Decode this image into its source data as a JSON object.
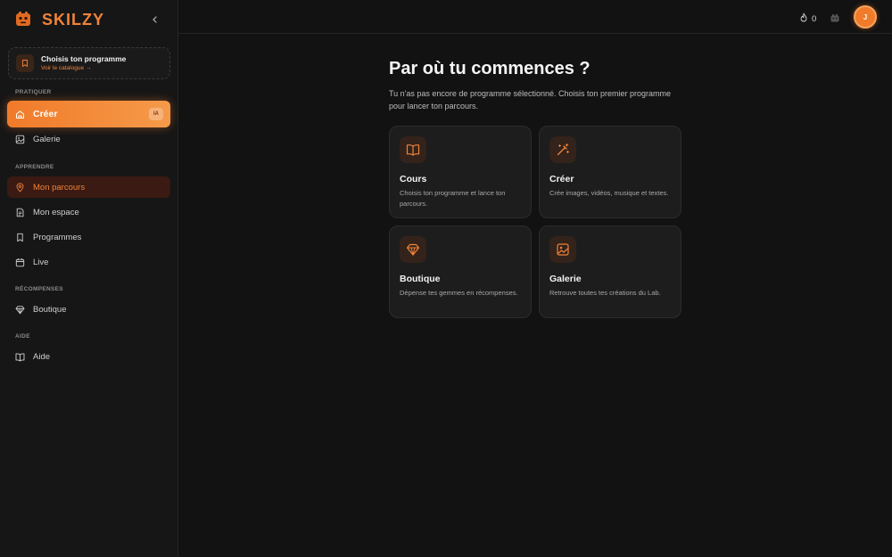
{
  "brand": {
    "name": "SKILZY",
    "accent": "#f0833a"
  },
  "sidebar": {
    "program_card": {
      "title": "Choisis ton programme",
      "link": "Voir le catalogue →"
    },
    "sections": {
      "pratiquer": "PRATIQUER",
      "apprendre": "APPRENDRE",
      "recompenses": "RÉCOMPENSES",
      "aide": "AIDE"
    },
    "items": {
      "creer": {
        "label": "Créer",
        "badge": "IA",
        "icon": "home-sparkle-icon"
      },
      "galerie": {
        "label": "Galerie",
        "icon": "image-icon"
      },
      "parcours": {
        "label": "Mon parcours",
        "icon": "map-pin-icon"
      },
      "espace": {
        "label": "Mon espace",
        "icon": "document-icon"
      },
      "programmes": {
        "label": "Programmes",
        "icon": "bookmark-icon"
      },
      "live": {
        "label": "Live",
        "icon": "calendar-icon"
      },
      "boutique": {
        "label": "Boutique",
        "icon": "gem-icon"
      },
      "aide": {
        "label": "Aide",
        "icon": "book-open-icon"
      }
    }
  },
  "topbar": {
    "streak_count": "0",
    "avatar_initial": "J"
  },
  "main": {
    "title": "Par où tu commences ?",
    "subtitle": "Tu n'as pas encore de programme sélectionné. Choisis ton premier programme pour lancer ton parcours.",
    "cards": [
      {
        "title": "Cours",
        "desc": "Choisis ton programme et lance ton parcours.",
        "icon": "book-open-icon"
      },
      {
        "title": "Créer",
        "desc": "Crée images, vidéos, musique et textes.",
        "icon": "magic-wand-icon"
      },
      {
        "title": "Boutique",
        "desc": "Dépense tes gemmes en récompenses.",
        "icon": "gem-icon"
      },
      {
        "title": "Galerie",
        "desc": "Retrouve toutes tes créations du Lab.",
        "icon": "image-icon"
      }
    ]
  }
}
